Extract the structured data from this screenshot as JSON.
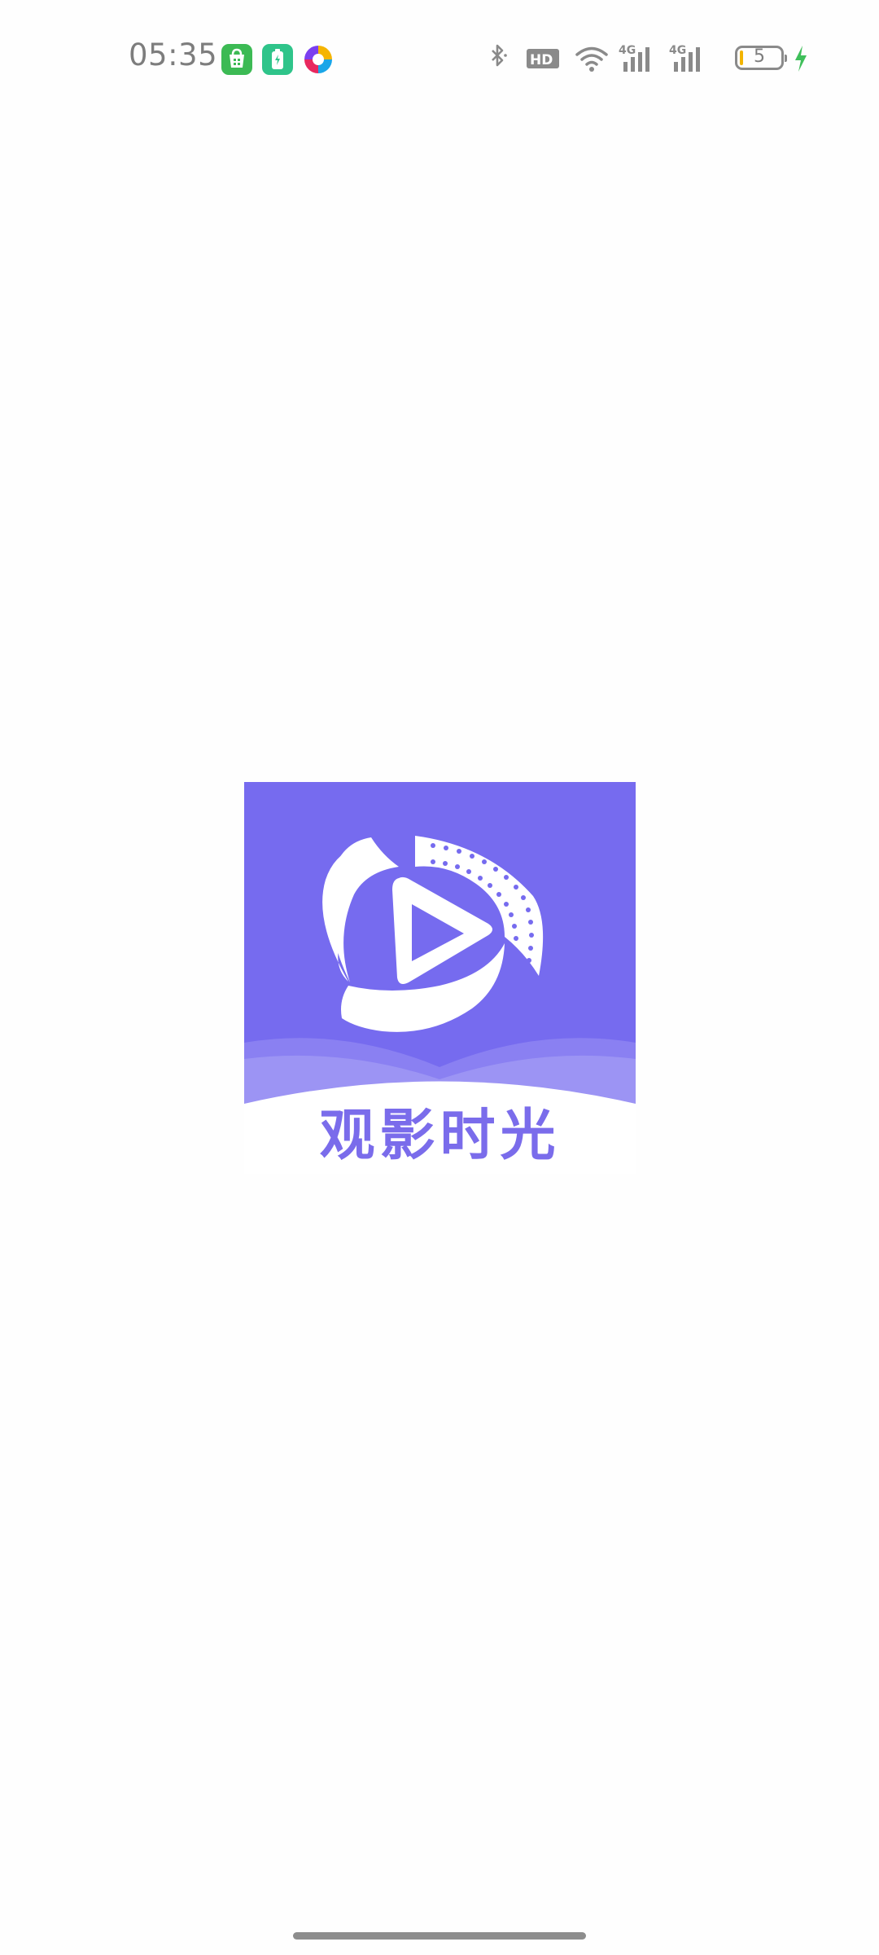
{
  "status_bar": {
    "time": "05:35",
    "notifications": [
      "shopping-bag-app-icon",
      "battery-saver-app-icon",
      "colorful-app-icon"
    ],
    "bluetooth": "bluetooth-icon",
    "hd_label": "HD",
    "wifi": "wifi-icon",
    "signal_1_label": "4G",
    "signal_2_label": "4G",
    "battery_level": "5",
    "charging": true,
    "colors": {
      "icon_gray": "#8a8a8a",
      "charging_green": "#3fbf5a",
      "battery_low_yellow": "#f2b400"
    }
  },
  "splash": {
    "app_name": "观影时光",
    "logo_icon": "film-play-logo-icon",
    "colors": {
      "brand_purple": "#766bef",
      "brand_text": "#7a6ceb",
      "background": "#fefefe"
    }
  },
  "system": {
    "home_indicator": "gesture-bar"
  }
}
